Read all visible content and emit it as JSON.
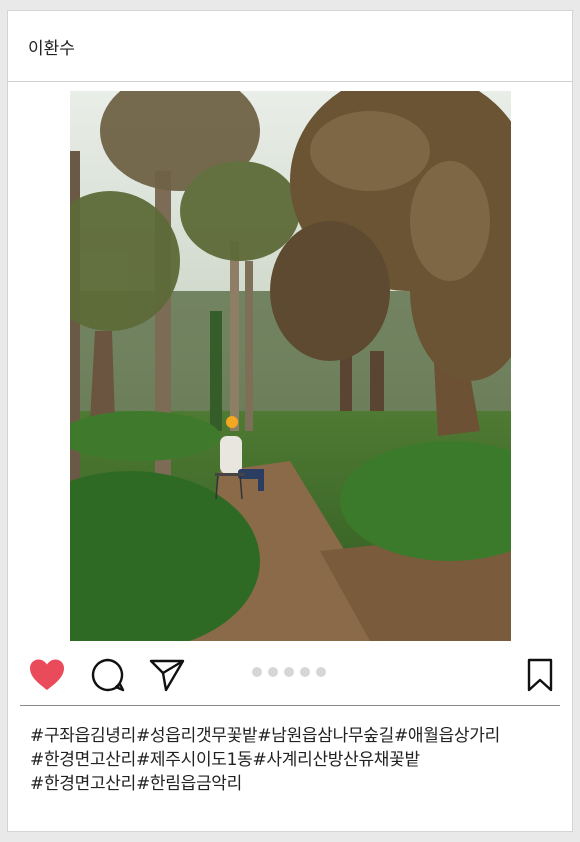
{
  "post": {
    "username": "이환수",
    "photo_icon": "palm-forest-photo",
    "carousel": {
      "total": 5,
      "active": 1
    },
    "caption_lines": [
      "#구좌읍김녕리#성읍리갯무꽃밭#남원읍삼나무숲길#애월읍상가리",
      "#한경면고산리#제주시이도1동#사계리산방산유채꽃밭",
      "#한경면고산리#한림읍금악리"
    ],
    "icons": {
      "like": "heart-icon",
      "comment": "comment-bubble-icon",
      "share": "send-arrow-icon",
      "save": "bookmark-icon"
    },
    "colors": {
      "like": "#e94b5a",
      "dot_inactive": "#d6d6d6"
    }
  }
}
